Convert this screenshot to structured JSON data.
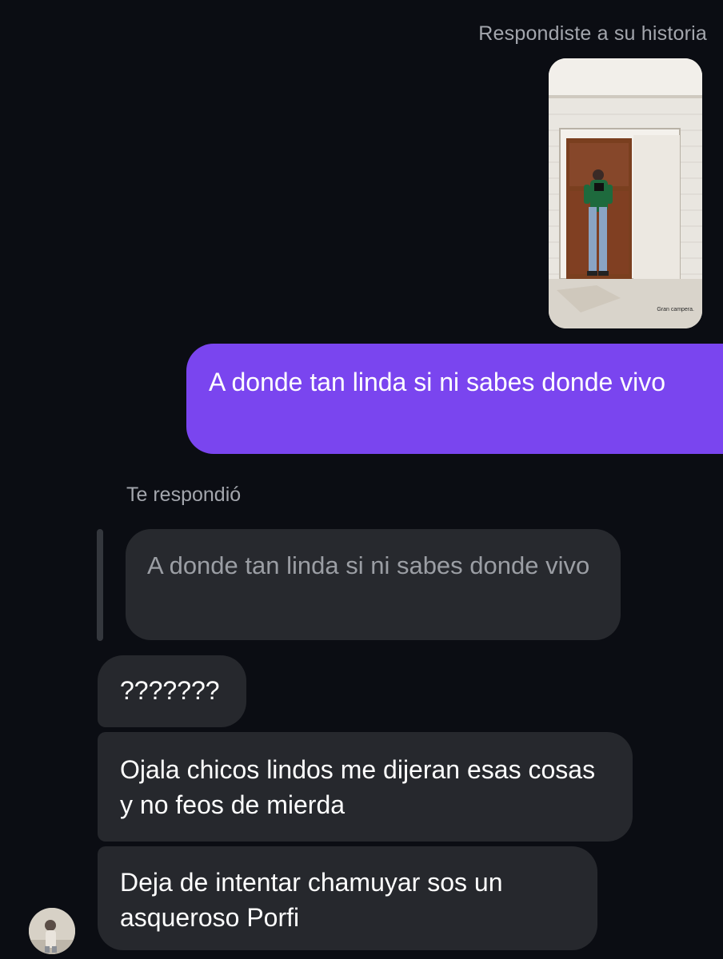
{
  "story": {
    "reply_label": "Respondiste a su historia",
    "caption": "Gran campera."
  },
  "messages": {
    "sent": {
      "text": "A donde tan linda si ni sabes donde vivo",
      "color": "#7a45ef"
    },
    "reply_label": "Te respondió",
    "quoted": {
      "text": "A donde tan linda si ni sabes donde vivo"
    },
    "received": [
      {
        "text": "???????"
      },
      {
        "text": "Ojala chicos lindos me dijeran esas cosas y no feos de mierda"
      },
      {
        "text": "Deja de intentar chamuyar sos un asqueroso Porfi"
      }
    ]
  },
  "icons": {
    "avatar": "profile-photo"
  }
}
